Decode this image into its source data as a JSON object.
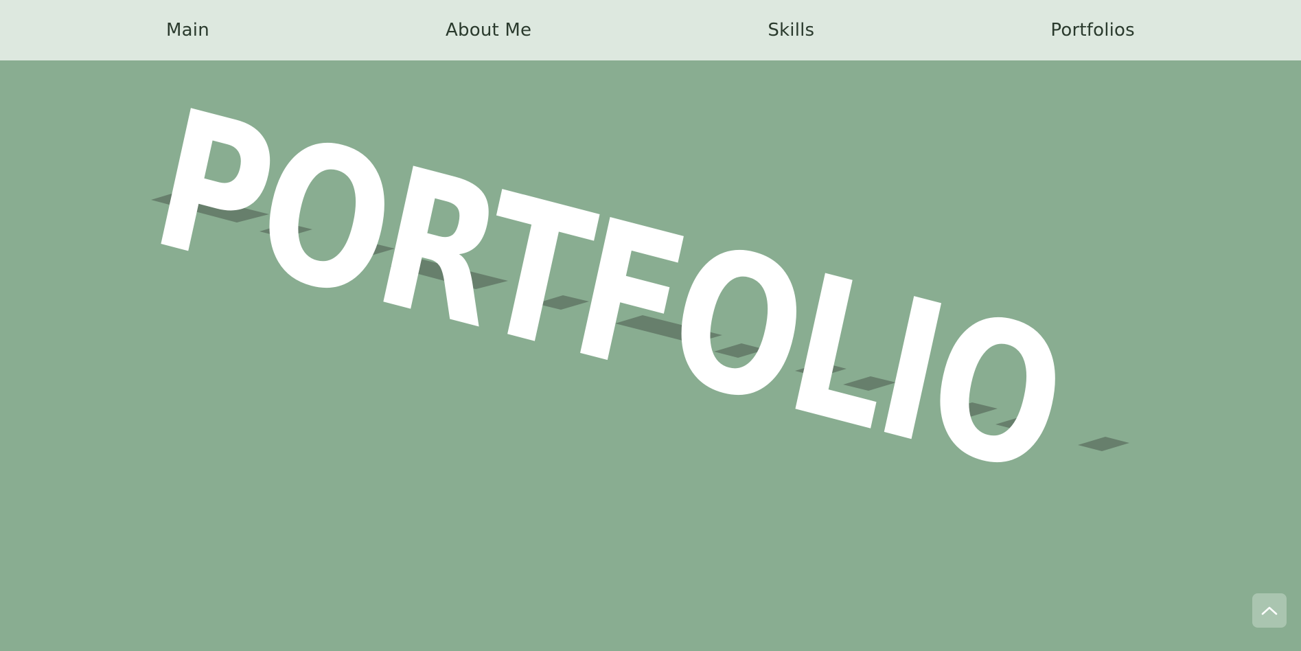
{
  "nav": {
    "items": [
      {
        "label": "Main"
      },
      {
        "label": "About Me"
      },
      {
        "label": "Skills"
      },
      {
        "label": "Portfolios"
      }
    ]
  },
  "hero": {
    "title": "PORTFOLIO"
  },
  "back_to_top": {
    "icon": "chevron-up-icon"
  },
  "colors": {
    "background": "#89ad91",
    "nav_background": "#dde8df",
    "nav_text": "#2a3a2d",
    "title_fill": "#ffffff",
    "title_shadow": "#677f6c",
    "button_background": "#aac5b0"
  }
}
